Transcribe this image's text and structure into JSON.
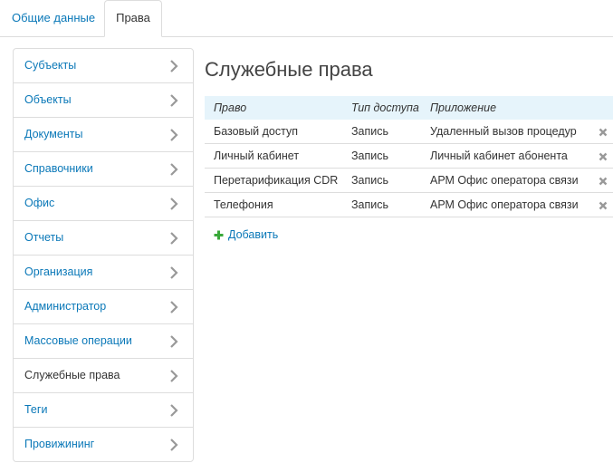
{
  "tabs": [
    {
      "label": "Общие данные",
      "active": false
    },
    {
      "label": "Права",
      "active": true
    }
  ],
  "sidebar": {
    "items": [
      {
        "label": "Субъекты"
      },
      {
        "label": "Объекты"
      },
      {
        "label": "Документы"
      },
      {
        "label": "Справочники"
      },
      {
        "label": "Офис"
      },
      {
        "label": "Отчеты"
      },
      {
        "label": "Организация"
      },
      {
        "label": "Администратор"
      },
      {
        "label": "Массовые операции"
      },
      {
        "label": "Служебные права",
        "current": true
      },
      {
        "label": "Теги"
      },
      {
        "label": "Провижининг"
      }
    ]
  },
  "main": {
    "title": "Служебные права",
    "table": {
      "headers": [
        "Право",
        "Тип доступа",
        "Приложение"
      ],
      "rows": [
        [
          "Базовый доступ",
          "Запись",
          "Удаленный вызов процедур"
        ],
        [
          "Личный кабинет",
          "Запись",
          "Личный кабинет абонента"
        ],
        [
          "Перетарификация CDR",
          "Запись",
          "АРМ Офис оператора связи"
        ],
        [
          "Телефония",
          "Запись",
          "АРМ Офис оператора связи"
        ]
      ]
    },
    "add_label": "Добавить"
  },
  "colors": {
    "link": "#0a78b8",
    "header_bg": "#e6f4fb",
    "add_icon": "#3aa83a",
    "delete_icon": "#999999"
  },
  "icons": {
    "sidebar_chevron": "chevron-right-icon",
    "row_delete": "close-icon",
    "add": "plus-icon"
  }
}
